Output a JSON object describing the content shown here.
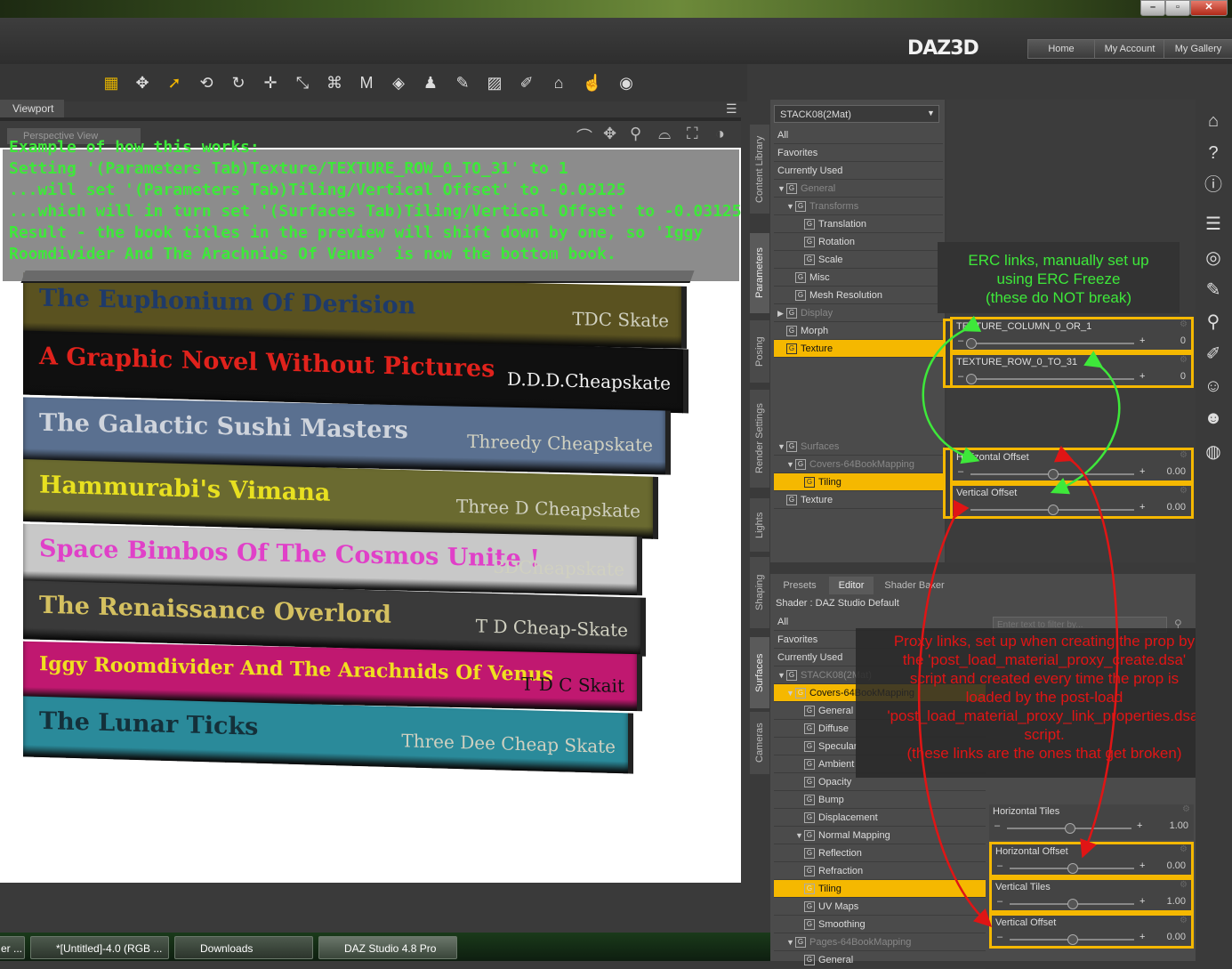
{
  "window": {
    "controls": [
      "–",
      "▫",
      "✕"
    ]
  },
  "header": {
    "logo": "DAZ3D",
    "nav": [
      "Home",
      "My Account",
      "My Gallery"
    ]
  },
  "viewport": {
    "tab": "Viewport",
    "camera": "Perspective View",
    "annotation": [
      "Example of how this works:",
      "Setting '(Parameters Tab)Texture/TEXTURE_ROW_0_TO_31' to 1",
      "...will set '(Parameters Tab)Tiling/Vertical Offset' to -0.03125",
      "...which will in turn set '(Surfaces Tab)Tiling/Vertical Offset' to -0.03125",
      "Result - the book titles in the preview will shift down by one, so 'Iggy",
      "Roomdivider And The Arachnids Of Venus' is now the bottom book."
    ],
    "books": [
      {
        "title": "The Euphonium Of Derision",
        "author": "TDC Skate",
        "bg": "#5a5220",
        "color": "#1e3a6a"
      },
      {
        "title": "A Graphic Novel Without Pictures",
        "author": "D.D.D.Cheapskate",
        "bg": "#101010",
        "color": "#e0221c"
      },
      {
        "title": "The Galactic Sushi Masters",
        "author": "Threedy Cheapskate",
        "bg": "#5a7090",
        "color": "#cfd4dc"
      },
      {
        "title": "Hammurabi's Vimana",
        "author": "Three D Cheapskate",
        "bg": "#6a6a30",
        "color": "#e8e020"
      },
      {
        "title": "Space Bimbos Of The Cosmos Unite !",
        "author": "3DCheapskate",
        "bg": "#c8c8c8",
        "color": "#e040c8"
      },
      {
        "title": "The Renaissance Overlord",
        "author": "T D Cheap-Skate",
        "bg": "#3a3a3a",
        "color": "#d4c060"
      },
      {
        "title": "Iggy Roomdivider And The Arachnids Of Venus",
        "author": "T D C Skait",
        "bg": "#c01870",
        "color": "#f0e020"
      },
      {
        "title": "The Lunar Ticks",
        "author": "Three Dee Cheap Skate",
        "bg": "#2a8a9a",
        "color": "#14303a"
      }
    ]
  },
  "side_tabs": [
    "Content Library",
    "Parameters",
    "Posing",
    "Render Settings",
    "Lights",
    "Shaping",
    "Surfaces",
    "Cameras"
  ],
  "parameters": {
    "dropdown": "STACK08(2Mat)",
    "rows": [
      {
        "label": "All",
        "indent": 0,
        "type": "plain"
      },
      {
        "label": "Favorites",
        "indent": 0,
        "type": "plain"
      },
      {
        "label": "Currently Used",
        "indent": 0,
        "type": "plain"
      },
      {
        "label": "General",
        "indent": 0,
        "type": "group-open",
        "dim": true
      },
      {
        "label": "Transforms",
        "indent": 1,
        "type": "group-open",
        "dim": true
      },
      {
        "label": "Translation",
        "indent": 2,
        "type": "item"
      },
      {
        "label": "Rotation",
        "indent": 2,
        "type": "item"
      },
      {
        "label": "Scale",
        "indent": 2,
        "type": "item"
      },
      {
        "label": "Misc",
        "indent": 1,
        "type": "item"
      },
      {
        "label": "Mesh Resolution",
        "indent": 1,
        "type": "item"
      },
      {
        "label": "Display",
        "indent": 0,
        "type": "group-closed",
        "dim": true
      },
      {
        "label": "Morph",
        "indent": 0,
        "type": "item"
      },
      {
        "label": "Texture",
        "indent": 0,
        "type": "item",
        "selected": true
      }
    ],
    "rows2": [
      {
        "label": "Surfaces",
        "indent": 0,
        "type": "group-open",
        "dim": true
      },
      {
        "label": "Covers-64BookMapping",
        "indent": 1,
        "type": "group-open",
        "dim": true
      },
      {
        "label": "Tiling",
        "indent": 2,
        "type": "item",
        "selected": true
      },
      {
        "label": "Texture",
        "indent": 0,
        "type": "item"
      }
    ],
    "sliders": [
      {
        "label": "TEXTURE_COLUMN_0_OR_1",
        "value": "0",
        "knob": 0.0
      },
      {
        "label": "TEXTURE_ROW_0_TO_31",
        "value": "0",
        "knob": 0.0
      },
      {
        "label": "Horizontal Offset",
        "value": "0.00",
        "knob": 0.5
      },
      {
        "label": "Vertical Offset",
        "value": "0.00",
        "knob": 0.5
      }
    ]
  },
  "erc_note": [
    "ERC links, manually set up",
    "using ERC Freeze",
    "(these do NOT break)"
  ],
  "surfaces": {
    "tabs": [
      "Presets",
      "Editor",
      "Shader Baker"
    ],
    "shader": "Shader : DAZ Studio Default",
    "filter_placeholder": "Enter text to filter by...",
    "rows": [
      {
        "label": "All",
        "indent": 0
      },
      {
        "label": "Favorites",
        "indent": 0
      },
      {
        "label": "Currently Used",
        "indent": 0
      },
      {
        "label": "STACK08(2Mat)",
        "indent": 0,
        "dim": true
      },
      {
        "label": "Covers-64BookMapping",
        "indent": 1,
        "selected": true
      },
      {
        "label": "General",
        "indent": 2
      },
      {
        "label": "Diffuse",
        "indent": 2
      },
      {
        "label": "Specular",
        "indent": 2
      },
      {
        "label": "Ambient",
        "indent": 2
      },
      {
        "label": "Opacity",
        "indent": 2
      },
      {
        "label": "Bump",
        "indent": 2
      },
      {
        "label": "Displacement",
        "indent": 2
      },
      {
        "label": "Normal Mapping",
        "indent": 2
      },
      {
        "label": "Reflection",
        "indent": 2
      },
      {
        "label": "Refraction",
        "indent": 2
      },
      {
        "label": "Tiling",
        "indent": 2,
        "selected": true
      },
      {
        "label": "UV Maps",
        "indent": 2
      },
      {
        "label": "Smoothing",
        "indent": 2
      },
      {
        "label": "Pages-64BookMapping",
        "indent": 1,
        "dim": true
      },
      {
        "label": "General",
        "indent": 2
      }
    ],
    "sliders": [
      {
        "label": "Horizontal Tiles",
        "value": "1.00",
        "knob": 0.5,
        "boxed": false
      },
      {
        "label": "Horizontal Offset",
        "value": "0.00",
        "knob": 0.5,
        "boxed": true
      },
      {
        "label": "Vertical Tiles",
        "value": "1.00",
        "knob": 0.5,
        "boxed": true
      },
      {
        "label": "Vertical Offset",
        "value": "0.00",
        "knob": 0.5,
        "boxed": true
      }
    ]
  },
  "proxy_note": [
    "Proxy links, set up when creating the prop by",
    "the 'post_load_material_proxy_create.dsa'",
    "script and created every time the prop is",
    "loaded by the post-load",
    "'post_load_material_proxy_link_properties.dsa'",
    "script.",
    "(these links are the ones that get broken)"
  ],
  "taskbar": [
    "er ...",
    "*[Untitled]-4.0 (RGB ...",
    "Downloads",
    "DAZ Studio 4.8 Pro"
  ],
  "colors": {
    "highlight": "#f5b800",
    "erc": "#3ee83a",
    "proxy": "#e01515"
  }
}
